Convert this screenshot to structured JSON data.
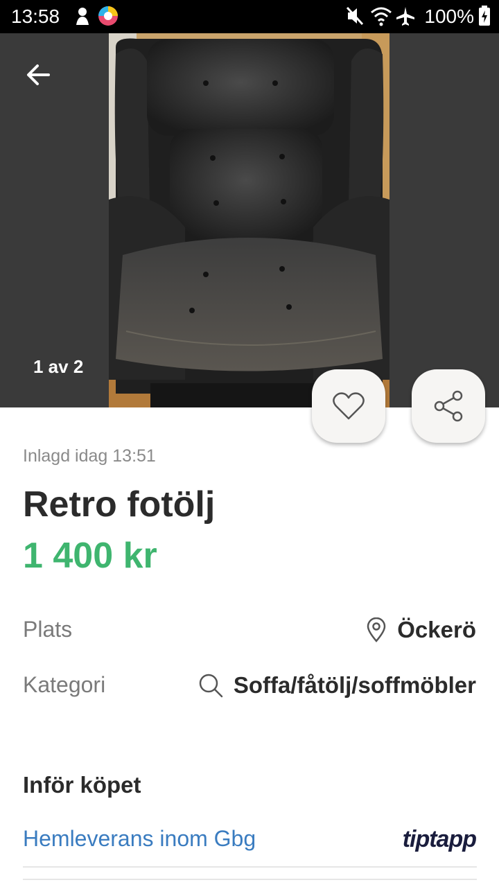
{
  "status_bar": {
    "time": "13:58",
    "battery": "100%",
    "icons": [
      "notification-icon",
      "app-icon",
      "mute-icon",
      "wifi-icon",
      "airplane-icon",
      "battery-icon"
    ]
  },
  "gallery": {
    "counter": "1 av 2"
  },
  "listing": {
    "posted": "Inlagd idag 13:51",
    "title": "Retro fotölj",
    "price": "1 400 kr"
  },
  "details": {
    "location_label": "Plats",
    "location_value": "Öckerö",
    "category_label": "Kategori",
    "category_value": "Soffa/fåtölj/soffmöbler"
  },
  "purchase": {
    "section_title": "Inför köpet",
    "delivery_link": "Hemleverans inom Gbg",
    "partner": "tiptapp"
  },
  "colors": {
    "price": "#3fb56f",
    "link": "#3a7cc0",
    "gallery_bg": "#3a3a3a"
  }
}
